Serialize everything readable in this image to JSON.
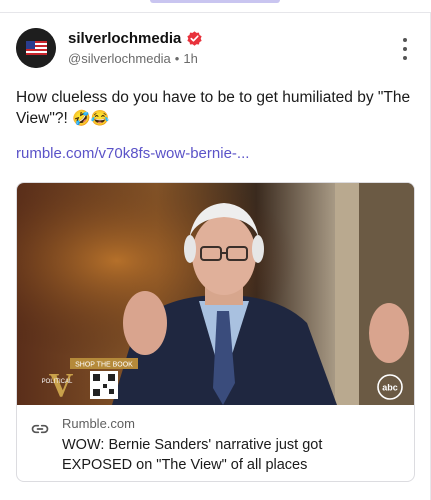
{
  "post": {
    "username": "silverlochmedia",
    "handle": "@silverlochmedia",
    "separator": "•",
    "time": "1h",
    "text": "How clueless do you have to be to get humiliated by \"The View\"?!",
    "emojis": "🤣😂",
    "link_text": "rumble.com/v70k8fs-wow-bernie-..."
  },
  "card": {
    "domain": "Rumble.com",
    "title": "WOW: Bernie Sanders' narrative just got EXPOSED on \"The View\" of all places",
    "overlay": {
      "shop_label": "SHOP THE BOOK",
      "brand_small": "POLITICAL",
      "brand_letter": "V",
      "network": "abc"
    }
  },
  "colors": {
    "link": "#5b53c8",
    "verified": "#e8323c",
    "meta": "#6a6a6a"
  },
  "icons": {
    "verified": "verified-badge-icon",
    "more": "more-vertical-icon",
    "link": "link-icon"
  }
}
